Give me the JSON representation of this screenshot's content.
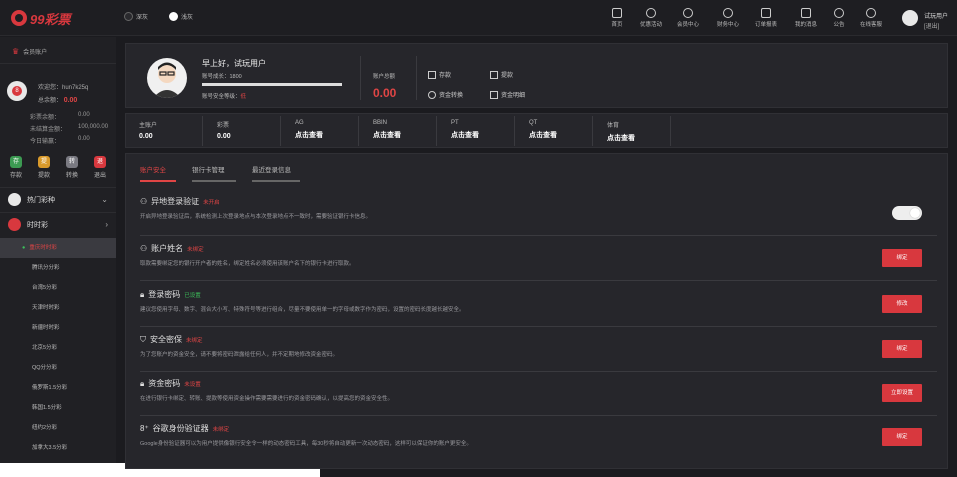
{
  "header": {
    "logo_text": "99彩票",
    "theme": {
      "dark_label": "深灰",
      "light_label": "浅灰"
    },
    "nav": [
      "首页",
      "优惠活动",
      "会员中心",
      "财务中心",
      "订单报表",
      "我的消息",
      "公告",
      "在线客服"
    ],
    "user": {
      "name": "试玩用户",
      "logout": "[退出]"
    }
  },
  "sidebar": {
    "title": "会员账户",
    "welcome": "欢迎您：hun7k25q",
    "total_assets_label": "总余额：",
    "total_assets_value": "0.00",
    "stats": [
      {
        "label": "彩票余额：",
        "value": "0.00"
      },
      {
        "label": "未结算金额：",
        "value": "100,000.00"
      },
      {
        "label": "今日输赢：",
        "value": "0.00"
      }
    ],
    "quick": [
      {
        "label": "存款",
        "glyph": "存",
        "color": "#3c9a52"
      },
      {
        "label": "提款",
        "glyph": "提",
        "color": "#d99a2b"
      },
      {
        "label": "转换",
        "glyph": "转",
        "color": "#7a7a82"
      },
      {
        "label": "退出",
        "glyph": "退",
        "color": "#d8383e"
      }
    ],
    "hot_games": "热门彩种",
    "ssc": "时时彩",
    "sub_items": [
      "重庆时时彩",
      "腾讯分分彩",
      "台湾5分彩",
      "天津时时彩",
      "新疆时时彩",
      "北京5分彩",
      "QQ分分彩",
      "俄罗斯1.5分彩",
      "韩国1.5分彩",
      "纽约2分彩",
      "加拿大3.5分彩"
    ]
  },
  "profile": {
    "greeting": "早上好，试玩用户",
    "points_label": "账号成长：1800",
    "security_label": "账号安全等级：",
    "security_level": "低",
    "balance_label": "账户总额",
    "balance_value": "0.00",
    "actions": [
      "存款",
      "提款",
      "资金转换",
      "资金明细"
    ]
  },
  "balances": [
    {
      "label": "主账户",
      "value": "0.00"
    },
    {
      "label": "彩票",
      "value": "0.00"
    },
    {
      "label": "AG",
      "value": "点击查看"
    },
    {
      "label": "BBIN",
      "value": "点击查看"
    },
    {
      "label": "PT",
      "value": "点击查看"
    },
    {
      "label": "QT",
      "value": "点击查看"
    },
    {
      "label": "体育",
      "value": "点击查看"
    }
  ],
  "tabs": [
    "账户安全",
    "银行卡管理",
    "最近登录信息"
  ],
  "security": [
    {
      "title": "异地登录验证",
      "status": "未开启",
      "status_ok": false,
      "desc": "开启异地登录验证后，系统检测上次登录地点与本次登录地点不一致时，需要验证银行卡信息。",
      "action": "toggle"
    },
    {
      "title": "账户姓名",
      "status": "未绑定",
      "status_ok": false,
      "desc": "取款需要绑定您的银行开户者的姓名，绑定姓名必须使用该账户名下的银行卡进行取款。",
      "action": "绑定"
    },
    {
      "title": "登录密码",
      "status": "已设置",
      "status_ok": true,
      "desc": "建议您使用字母、数字、混合大小写、特殊符号等进行组合，尽量不要使用单一的字母或数字作为密码，设置的密码长度越长越安全。",
      "action": "修改"
    },
    {
      "title": "安全密保",
      "status": "未绑定",
      "status_ok": false,
      "desc": "为了您账户的资金安全，请不要将密码泄露给任何人，并不定期地修改资金密码。",
      "action": "绑定"
    },
    {
      "title": "资金密码",
      "status": "未设置",
      "status_ok": false,
      "desc": "在进行银行卡绑定、转账、提款等使用资金操作需要需要进行的资金密码确认，以提高您的资金安全性。",
      "action": "立即设置"
    },
    {
      "title": "谷歌身份验证器",
      "status": "未绑定",
      "status_ok": false,
      "desc": "Google身份验证器可以为用户提供像银行安全令一样的动态密码工具，每30秒将自动更新一次动态密码，这样可以保证你的账户更安全。",
      "action": "绑定"
    }
  ]
}
